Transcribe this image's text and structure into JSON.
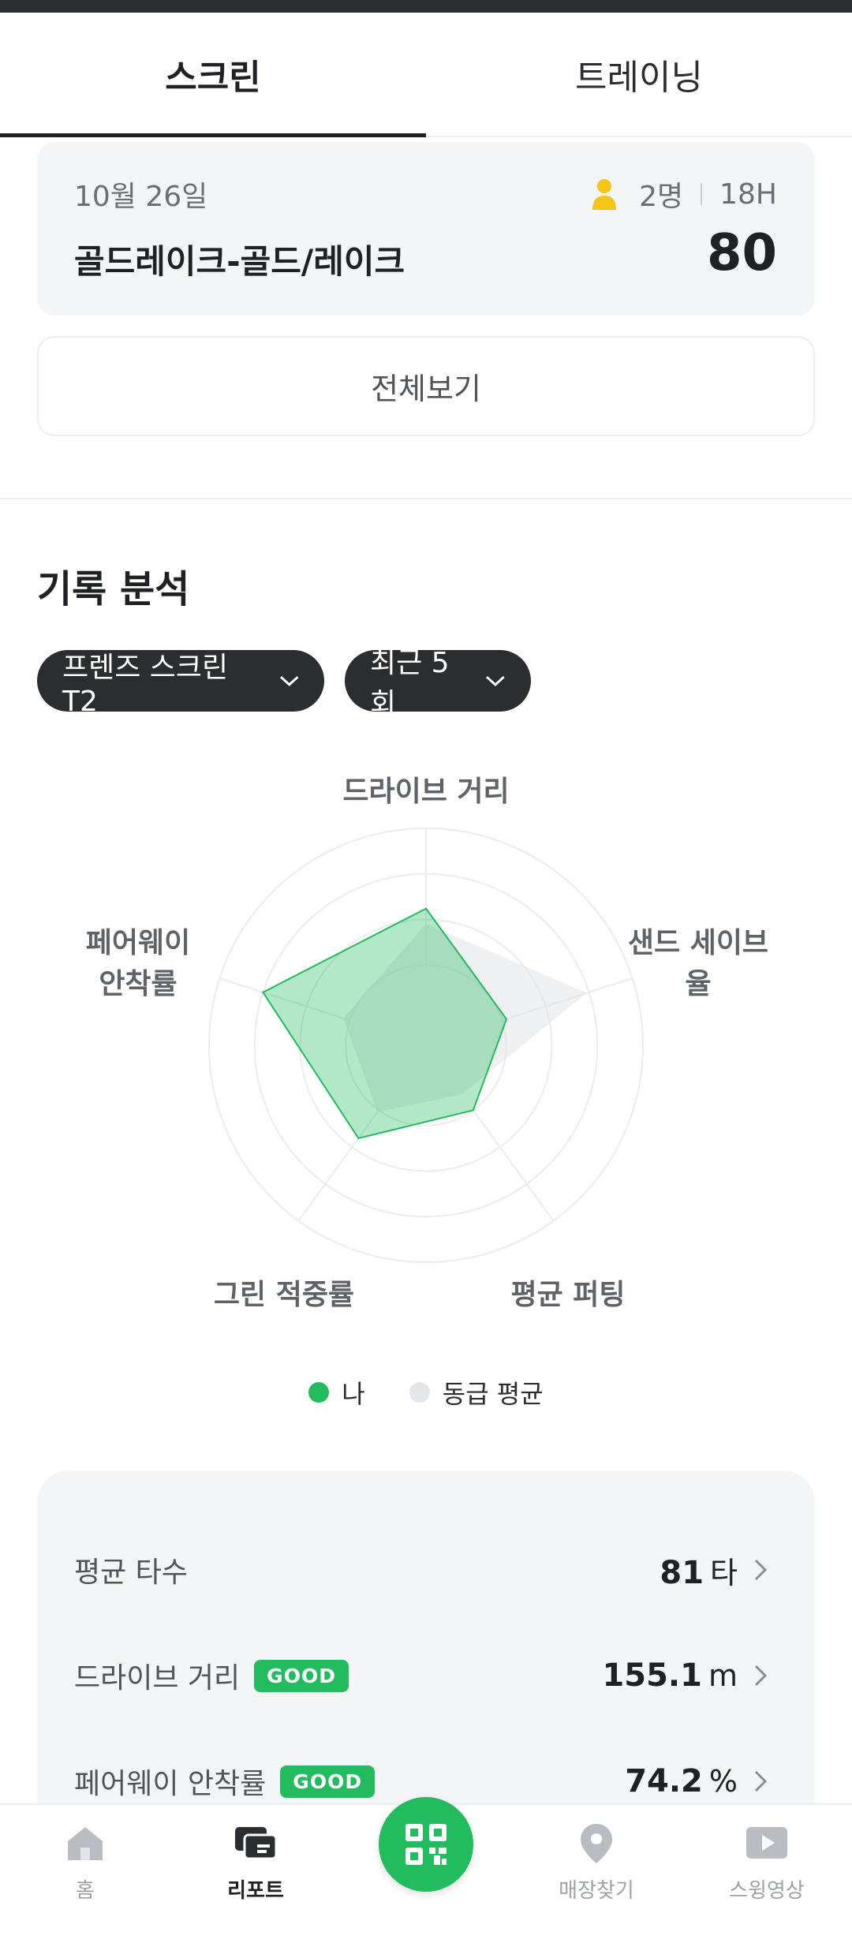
{
  "tabs": [
    {
      "label": "스크린",
      "active": true
    },
    {
      "label": "트레이닝",
      "active": false
    }
  ],
  "round": {
    "date": "10월 26일",
    "players": "2명",
    "holes": "18H",
    "course": "골드레이크-골드/레이크",
    "score": "80",
    "icon": "person-icon"
  },
  "view_all_label": "전체보기",
  "analysis": {
    "title": "기록 분석",
    "store_filter": "프렌즈 스크린 T2",
    "period_filter": "최근 5회"
  },
  "chart_data": {
    "type": "radar",
    "axes": [
      "드라이브 거리",
      "샌드 세이브율",
      "평균 퍼팅",
      "그린 적중률",
      "페어웨이 안착률"
    ],
    "rlim": [
      0,
      1
    ],
    "series": [
      {
        "name": "나",
        "color": "#22bb5e",
        "values": [
          0.63,
          0.39,
          0.37,
          0.53,
          0.79
        ]
      },
      {
        "name": "동급 평균",
        "color": "#e8e9ec",
        "values": [
          0.56,
          0.78,
          0.28,
          0.38,
          0.4
        ]
      }
    ],
    "grid": true
  },
  "legend": {
    "me": "나",
    "avg": "동급 평균"
  },
  "stats": [
    {
      "label": "평균 타수",
      "badge": "",
      "value": "81",
      "unit": "타"
    },
    {
      "label": "드라이브 거리",
      "badge": "GOOD",
      "value": "155.1",
      "unit": "m"
    },
    {
      "label": "페어웨이 안착률",
      "badge": "GOOD",
      "value": "74.2",
      "unit": "%"
    }
  ],
  "nav": [
    {
      "label": "홈",
      "icon": "home-icon",
      "active": false
    },
    {
      "label": "리포트",
      "icon": "report-icon",
      "active": true
    },
    {
      "label": "",
      "icon": "qr-code-icon",
      "active": false
    },
    {
      "label": "매장찾기",
      "icon": "location-pin-icon",
      "active": false
    },
    {
      "label": "스윙영상",
      "icon": "play-video-icon",
      "active": false
    }
  ],
  "colors": {
    "brand_green": "#22bb5e",
    "dark": "#2b2d31",
    "person_icon": "#f5c518"
  }
}
